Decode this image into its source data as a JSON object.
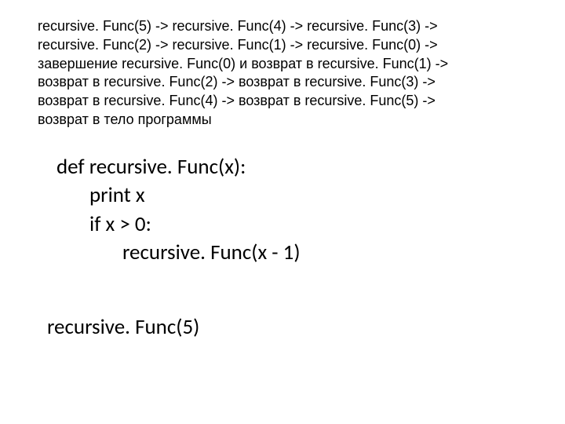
{
  "trace": {
    "line1": "recursive. Func(5) -> recursive. Func(4) -> recursive. Func(3) ->",
    "line2": "recursive. Func(2) -> recursive. Func(1) -> recursive. Func(0) ->",
    "line3": "завершение recursive. Func(0) и возврат в recursive. Func(1) ->",
    "line4": "возврат в recursive. Func(2) -> возврат в recursive. Func(3) ->",
    "line5": "возврат в recursive. Func(4) -> возврат в recursive. Func(5) ->",
    "line6": "возврат в тело программы"
  },
  "code": {
    "l1": "def recursive. Func(x):",
    "l2": "print x",
    "l3": "if x > 0:",
    "l4": "recursive. Func(x - 1)"
  },
  "call": "recursive. Func(5)"
}
